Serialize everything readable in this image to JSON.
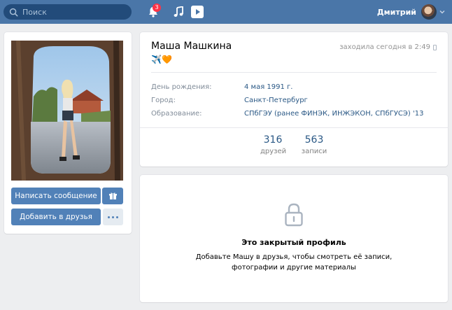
{
  "header": {
    "search_placeholder": "Поиск",
    "notifications_count": "3",
    "user_name": "Дмитрий"
  },
  "profile": {
    "name": "Маша Машкина",
    "status_emoji": "✈️🧡",
    "last_seen": "заходила сегодня в 2:49",
    "fields": [
      {
        "label": "День рождения:",
        "value": "4 мая 1991 г."
      },
      {
        "label": "Город:",
        "value": "Санкт-Петербург"
      },
      {
        "label": "Образование:",
        "value": "СПбГЭУ (ранее ФИНЭК, ИНЖЭКОН, СПбГУСЭ) '13"
      }
    ],
    "counters": [
      {
        "num": "316",
        "label": "друзей"
      },
      {
        "num": "563",
        "label": "записи"
      }
    ]
  },
  "actions": {
    "message": "Написать сообщение",
    "add_friend": "Добавить в друзья"
  },
  "closed": {
    "title": "Это закрытый профиль",
    "description": "Добавьте Машу в друзья, чтобы смотреть её записи, фотографии и другие материалы"
  },
  "colors": {
    "header": "#4a76a8",
    "button": "#5181b8",
    "link": "#2a5885",
    "background": "#edeef0"
  }
}
